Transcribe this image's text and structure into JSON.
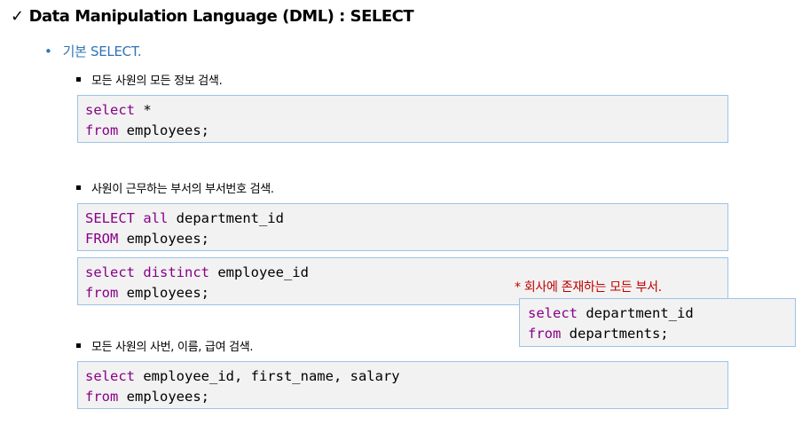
{
  "title": "Data Manipulation Language (DML) : SELECT",
  "subtitle": "기본 SELECT.",
  "sections": [
    {
      "label": "모든 사원의 모든 정보 검색.",
      "blocks": [
        {
          "line1_kw": "select",
          "line1_rest": " *",
          "line2_kw": "from",
          "line2_rest": " employees;"
        }
      ]
    },
    {
      "label": "사원이 근무하는 부서의 부서번호 검색.",
      "blocks": [
        {
          "line1_kw": "SELECT all",
          "line1_rest": " department_id",
          "line2_kw": "FROM",
          "line2_rest": " employees;"
        },
        {
          "line1_kw": "select distinct",
          "line1_rest": " employee_id",
          "line2_kw": "from",
          "line2_rest": " employees;"
        }
      ],
      "note": "* 회사에 존재하는 모든 부서.",
      "side_block": {
        "line1_kw": "select",
        "line1_rest": " department_id",
        "line2_kw": "from",
        "line2_rest": " departments;"
      }
    },
    {
      "label": "모든 사원의 사번, 이름, 급여 검색.",
      "blocks": [
        {
          "line1_kw": "select",
          "line1_rest": " employee_id, first_name, salary",
          "line2_kw": "from",
          "line2_rest": " employees;"
        }
      ]
    }
  ],
  "colors": {
    "keyword": "#880088",
    "subtitle": "#2e74b5",
    "note": "#c00000",
    "code_bg": "#f2f2f2",
    "code_border": "#9dc3e6"
  }
}
